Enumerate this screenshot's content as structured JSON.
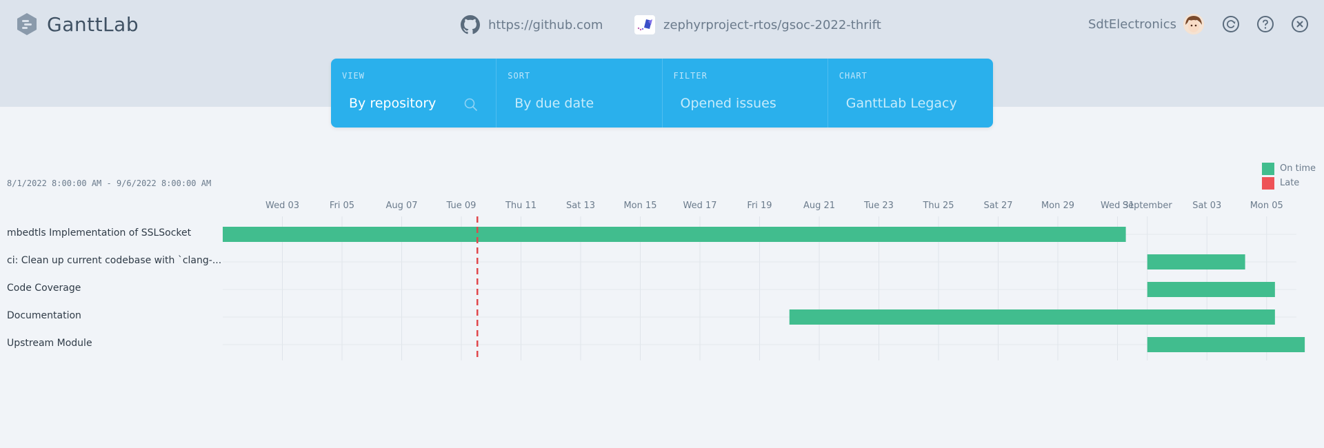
{
  "app": {
    "name": "GanttLab"
  },
  "source": {
    "url": "https://github.com"
  },
  "repository": {
    "name": "zephyrproject-rtos/gsoc-2022-thrift"
  },
  "user": {
    "name": "SdtElectronics"
  },
  "toolbar": {
    "view": {
      "label": "VIEW",
      "value": "By repository"
    },
    "sort": {
      "label": "SORT",
      "value": "By due date"
    },
    "filter": {
      "label": "FILTER",
      "value": "Opened issues"
    },
    "chart": {
      "label": "CHART",
      "value": "GanttLab Legacy"
    }
  },
  "gantt": {
    "date_range": "8/1/2022 8:00:00 AM - 9/6/2022 8:00:00 AM",
    "legend": [
      {
        "label": "On time",
        "color": "#41bd8e"
      },
      {
        "label": "Late",
        "color": "#ee5257"
      }
    ],
    "ticks": [
      "Wed 03",
      "Fri 05",
      "Aug 07",
      "Tue 09",
      "Thu 11",
      "Sat 13",
      "Mon 15",
      "Wed 17",
      "Fri 19",
      "Aug 21",
      "Tue 23",
      "Thu 25",
      "Sat 27",
      "Mon 29",
      "Wed 31",
      "September",
      "Sat 03",
      "Mon 05"
    ],
    "today": "2022-08-10",
    "tasks": [
      {
        "title": "mbedtls Implementation of SSLSocket",
        "start": "2022-08-01",
        "end": "2022-08-31",
        "status": "On time"
      },
      {
        "title": "ci: Clean up current codebase with `clang-...",
        "start": "2022-09-01",
        "end": "2022-09-04",
        "status": "On time"
      },
      {
        "title": "Code Coverage",
        "start": "2022-09-01",
        "end": "2022-09-05",
        "status": "On time"
      },
      {
        "title": "Documentation",
        "start": "2022-08-20",
        "end": "2022-09-05",
        "status": "On time"
      },
      {
        "title": "Upstream Module",
        "start": "2022-09-01",
        "end": "2022-09-06",
        "status": "On time"
      }
    ]
  }
}
